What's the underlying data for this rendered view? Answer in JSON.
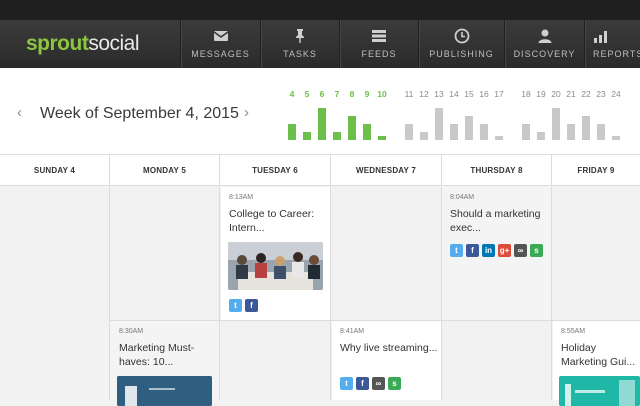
{
  "brand": {
    "part1": "sprout",
    "part2": "social"
  },
  "nav": {
    "items": [
      {
        "label": "MESSAGES",
        "icon": "envelope-icon"
      },
      {
        "label": "TASKS",
        "icon": "pin-icon"
      },
      {
        "label": "FEEDS",
        "icon": "list-icon"
      },
      {
        "label": "PUBLISHING",
        "icon": "clock-icon"
      },
      {
        "label": "DISCOVERY",
        "icon": "user-icon"
      },
      {
        "label": "REPORTS",
        "icon": "bar-chart-icon"
      }
    ]
  },
  "header": {
    "week_title": "Week of September 4, 2015",
    "prev_label": "‹",
    "next_label": "›"
  },
  "chart_data": {
    "type": "bar",
    "categories": [
      "4",
      "5",
      "6",
      "7",
      "8",
      "9",
      "10",
      "11",
      "12",
      "13",
      "14",
      "15",
      "16",
      "17",
      "18",
      "19",
      "20",
      "21",
      "22",
      "23",
      "24"
    ],
    "values": [
      2,
      1,
      4,
      1,
      3,
      2,
      0.5,
      2,
      1,
      4,
      2,
      3,
      2,
      0.5,
      2,
      1,
      4,
      2,
      3,
      2,
      0.5
    ],
    "highlight_count": 7,
    "colors": {
      "active": "#6cc04a",
      "inactive": "#c8c8c8",
      "active_label": "#6cc04a",
      "inactive_label": "#8a8a8a"
    }
  },
  "days": [
    "SUNDAY 4",
    "MONDAY 5",
    "TUESDAY 6",
    "WEDNESDAY 7",
    "THURSDAY 8",
    "FRIDAY 9"
  ],
  "posts": {
    "tue": {
      "time": "8:13AM",
      "title": "College to Career: Intern..."
    },
    "thu": {
      "time": "8:04AM",
      "title": "Should a marketing exec..."
    },
    "mon": {
      "time": "8:30AM",
      "title": "Marketing Must-haves: 10..."
    },
    "wed": {
      "time": "8:41AM",
      "title": "Why live streaming..."
    },
    "fri": {
      "time": "8:55AM",
      "title": "Holiday Marketing Gui..."
    }
  },
  "network_icons": {
    "twitter": "t",
    "facebook": "f",
    "linkedin": "in",
    "googleplus": "g+",
    "link": "∞",
    "sprout": "s"
  }
}
